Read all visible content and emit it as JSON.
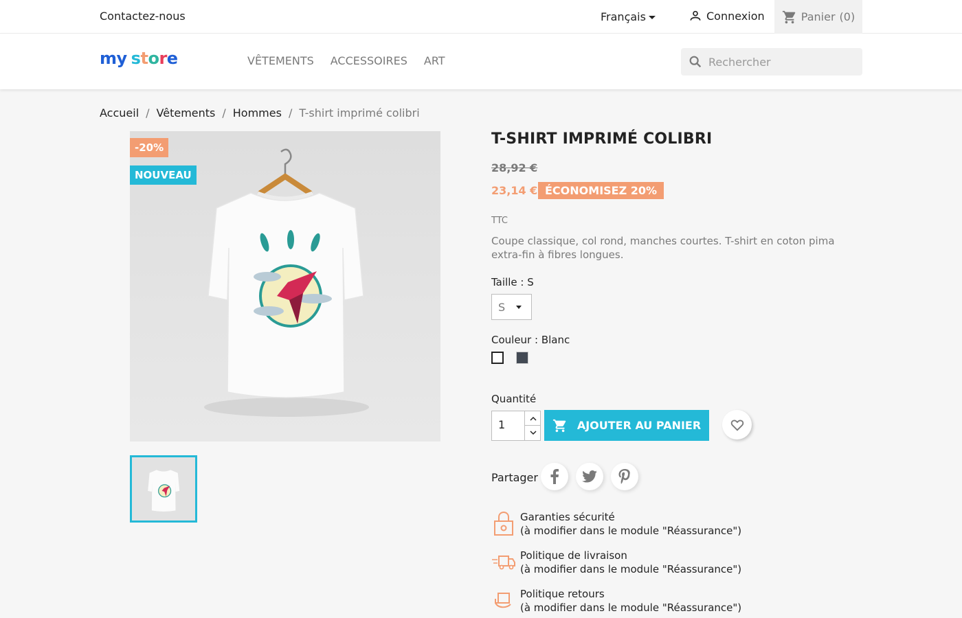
{
  "topbar": {
    "contact": "Contactez-nous",
    "language": "Français",
    "login": "Connexion",
    "cart_label": "Panier",
    "cart_count": "(0)"
  },
  "header": {
    "logo": {
      "my": "my",
      "store": "store"
    },
    "menu": [
      "VÊTEMENTS",
      "ACCESSOIRES",
      "ART"
    ],
    "search_placeholder": "Rechercher"
  },
  "breadcrumb": [
    "Accueil",
    "Vêtements",
    "Hommes",
    "T-shirt imprimé colibri"
  ],
  "product": {
    "flags": {
      "discount": "-20%",
      "new": "NOUVEAU"
    },
    "title": "T-SHIRT IMPRIMÉ COLIBRI",
    "old_price": "28,92 €",
    "price": "23,14 €",
    "saving": "ÉCONOMISEZ 20%",
    "tax_label": "TTC",
    "description": "Coupe classique, col rond, manches courtes. T-shirt en coton pima extra-fin à fibres longues.",
    "size_label": "Taille : S",
    "size_value": "S",
    "color_label": "Couleur : Blanc",
    "colors": [
      "#ffffff",
      "#434a54"
    ],
    "quantity_label": "Quantité",
    "quantity": "1",
    "add_to_cart": "AJOUTER AU PANIER",
    "share_label": "Partager"
  },
  "reassurance": [
    {
      "title": "Garanties sécurité",
      "subtitle": "(à modifier dans le module \"Réassurance\")"
    },
    {
      "title": "Politique de livraison",
      "subtitle": "(à modifier dans le module \"Réassurance\")"
    },
    {
      "title": "Politique retours",
      "subtitle": "(à modifier dans le module \"Réassurance\")"
    }
  ],
  "colors": {
    "accent": "#24b9d7",
    "discount": "#f39d72",
    "muted": "#7a7a7a",
    "text": "#232323"
  }
}
